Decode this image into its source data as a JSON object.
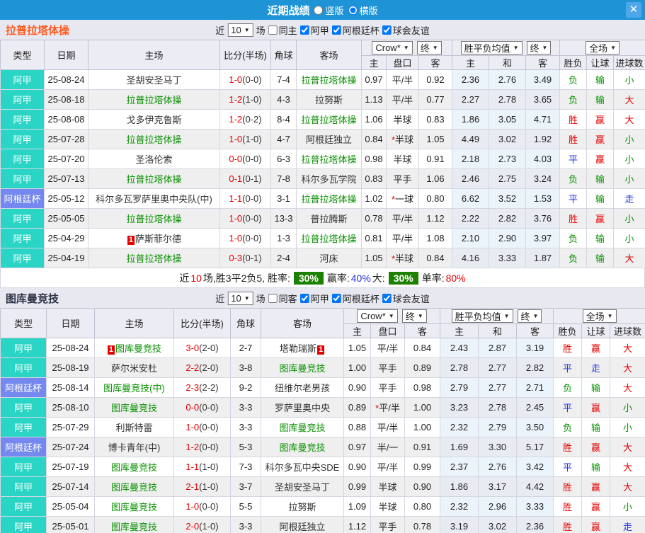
{
  "titlebar": {
    "title": "近期战绩",
    "radio_vertical": {
      "label": "竖版",
      "checked": false
    },
    "radio_horizontal": {
      "label": "横版",
      "checked": true
    },
    "close_glyph": "✕"
  },
  "table_header": {
    "col_type": "类型",
    "col_date": "日期",
    "col_home": "主场",
    "col_score": "比分(半场)",
    "col_corner": "角球",
    "col_away": "客场",
    "sel_crow": "Crow*",
    "sel_end1": "终",
    "sel_mean": "胜平负均值",
    "sel_end2": "终",
    "sel_full": "全场",
    "sub_home": "主",
    "sub_handicap": "盘口",
    "sub_away": "客",
    "sub_mean_home": "主",
    "sub_mean_draw": "和",
    "sub_mean_away": "客",
    "sub_result": "胜负",
    "sub_let": "让球",
    "sub_goals": "进球数"
  },
  "colors": {
    "titlebar_blue": "#1e93d6",
    "league_ajia": "#2bd5c5",
    "league_cup": "#7488ef",
    "focus_green": "#089000",
    "win_red": "#e60000",
    "draw_blue": "#2233dd",
    "chip_green": "#1d8000",
    "section1_title_orange": "#ff5a1e"
  },
  "sections": [
    {
      "title": "拉普拉塔体操",
      "filter": {
        "near": "近",
        "count": "10",
        "games": "场",
        "same": {
          "label": "同主",
          "checked": false
        },
        "leagues": [
          {
            "label": "阿甲",
            "checked": true
          },
          {
            "label": "阿根廷杯",
            "checked": true
          },
          {
            "label": "球会友谊",
            "checked": true
          }
        ]
      },
      "rows": [
        {
          "league": "阿甲",
          "lg": "ajia",
          "date": "25-08-24",
          "home": {
            "name": "圣胡安圣马丁",
            "focus": false
          },
          "score": "1-0",
          "half": "(0-0)",
          "corner": "7-4",
          "away": {
            "name": "拉普拉塔体操",
            "focus": true
          },
          "crow_home": "0.97",
          "handicap": "平/半",
          "star": false,
          "crow_away": "0.92",
          "mean": [
            "2.36",
            "2.76",
            "3.49"
          ],
          "res": [
            "负",
            "g"
          ],
          "let": [
            "输",
            "g"
          ],
          "big": [
            "小",
            "g"
          ]
        },
        {
          "league": "阿甲",
          "lg": "ajia",
          "date": "25-08-18",
          "home": {
            "name": "拉普拉塔体操",
            "focus": true
          },
          "score": "1-2",
          "half": "(1-0)",
          "corner": "4-3",
          "away": {
            "name": "拉努斯",
            "focus": false
          },
          "crow_home": "1.13",
          "handicap": "平/半",
          "star": false,
          "crow_away": "0.77",
          "mean": [
            "2.27",
            "2.78",
            "3.65"
          ],
          "res": [
            "负",
            "g"
          ],
          "let": [
            "输",
            "g"
          ],
          "big": [
            "大",
            "r"
          ]
        },
        {
          "league": "阿甲",
          "lg": "ajia",
          "date": "25-08-08",
          "home": {
            "name": "戈多伊克鲁斯",
            "focus": false
          },
          "score": "1-2",
          "half": "(0-2)",
          "corner": "8-4",
          "away": {
            "name": "拉普拉塔体操",
            "focus": true
          },
          "crow_home": "1.06",
          "handicap": "半球",
          "star": false,
          "crow_away": "0.83",
          "mean": [
            "1.86",
            "3.05",
            "4.71"
          ],
          "res": [
            "胜",
            "r"
          ],
          "let": [
            "赢",
            "r"
          ],
          "big": [
            "大",
            "r"
          ]
        },
        {
          "league": "阿甲",
          "lg": "ajia",
          "date": "25-07-28",
          "home": {
            "name": "拉普拉塔体操",
            "focus": true
          },
          "score": "1-0",
          "half": "(1-0)",
          "corner": "4-7",
          "away": {
            "name": "阿根廷独立",
            "focus": false
          },
          "crow_home": "0.84",
          "handicap": "半球",
          "star": true,
          "crow_away": "1.05",
          "mean": [
            "4.49",
            "3.02",
            "1.92"
          ],
          "res": [
            "胜",
            "r"
          ],
          "let": [
            "赢",
            "r"
          ],
          "big": [
            "小",
            "g"
          ]
        },
        {
          "league": "阿甲",
          "lg": "ajia",
          "date": "25-07-20",
          "home": {
            "name": "圣洛伦索",
            "focus": false
          },
          "score": "0-0",
          "half": "(0-0)",
          "corner": "6-3",
          "away": {
            "name": "拉普拉塔体操",
            "focus": true
          },
          "crow_home": "0.98",
          "handicap": "半球",
          "star": false,
          "crow_away": "0.91",
          "mean": [
            "2.18",
            "2.73",
            "4.03"
          ],
          "res": [
            "平",
            "b"
          ],
          "let": [
            "赢",
            "r"
          ],
          "big": [
            "小",
            "g"
          ]
        },
        {
          "league": "阿甲",
          "lg": "ajia",
          "date": "25-07-13",
          "home": {
            "name": "拉普拉塔体操",
            "focus": true
          },
          "score": "0-1",
          "half": "(0-1)",
          "corner": "7-8",
          "away": {
            "name": "科尔多瓦学院",
            "focus": false
          },
          "crow_home": "0.83",
          "handicap": "平手",
          "star": false,
          "crow_away": "1.06",
          "mean": [
            "2.46",
            "2.75",
            "3.24"
          ],
          "res": [
            "负",
            "g"
          ],
          "let": [
            "输",
            "g"
          ],
          "big": [
            "小",
            "g"
          ]
        },
        {
          "league": "阿根廷杯",
          "lg": "cup",
          "date": "25-05-12",
          "home": {
            "name": "科尔多瓦罗萨里奥中央队(中)",
            "focus": false
          },
          "score": "1-1",
          "half": "(0-0)",
          "corner": "3-1",
          "away": {
            "name": "拉普拉塔体操",
            "focus": true
          },
          "crow_home": "1.02",
          "handicap": "一球",
          "star": true,
          "crow_away": "0.80",
          "mean": [
            "6.62",
            "3.52",
            "1.53"
          ],
          "res": [
            "平",
            "b"
          ],
          "let": [
            "输",
            "g"
          ],
          "big": [
            "走",
            "b"
          ]
        },
        {
          "league": "阿甲",
          "lg": "ajia",
          "date": "25-05-05",
          "home": {
            "name": "拉普拉塔体操",
            "focus": true
          },
          "score": "1-0",
          "half": "(0-0)",
          "corner": "13-3",
          "away": {
            "name": "普拉腾斯",
            "focus": false
          },
          "crow_home": "0.78",
          "handicap": "平/半",
          "star": false,
          "crow_away": "1.12",
          "mean": [
            "2.22",
            "2.82",
            "3.76"
          ],
          "res": [
            "胜",
            "r"
          ],
          "let": [
            "赢",
            "r"
          ],
          "big": [
            "小",
            "g"
          ]
        },
        {
          "league": "阿甲",
          "lg": "ajia",
          "date": "25-04-29",
          "home": {
            "name": "萨斯菲尔德",
            "focus": false,
            "pre": "1"
          },
          "score": "1-0",
          "half": "(0-0)",
          "corner": "1-3",
          "away": {
            "name": "拉普拉塔体操",
            "focus": true
          },
          "crow_home": "0.81",
          "handicap": "平/半",
          "star": false,
          "crow_away": "1.08",
          "mean": [
            "2.10",
            "2.90",
            "3.97"
          ],
          "res": [
            "负",
            "g"
          ],
          "let": [
            "输",
            "g"
          ],
          "big": [
            "小",
            "g"
          ]
        },
        {
          "league": "阿甲",
          "lg": "ajia",
          "date": "25-04-19",
          "home": {
            "name": "拉普拉塔体操",
            "focus": true
          },
          "score": "0-3",
          "half": "(0-1)",
          "corner": "2-4",
          "away": {
            "name": "河床",
            "focus": false
          },
          "crow_home": "1.05",
          "handicap": "半球",
          "star": true,
          "crow_away": "0.84",
          "mean": [
            "4.16",
            "3.33",
            "1.87"
          ],
          "res": [
            "负",
            "g"
          ],
          "let": [
            "输",
            "g"
          ],
          "big": [
            "大",
            "r"
          ]
        }
      ],
      "summary": {
        "seg1": "近",
        "num1": "10",
        "seg2": "场,胜3平2负5, 胜率:",
        "chip1": "30%",
        "seg3": "赢率:",
        "val1": "40%",
        "seg4": "大:",
        "chip2": "30%",
        "seg5": "单率:",
        "val2": "80%"
      }
    },
    {
      "title": "图库曼竞技",
      "filter": {
        "near": "近",
        "count": "10",
        "games": "场",
        "same": {
          "label": "同客",
          "checked": false
        },
        "leagues": [
          {
            "label": "阿甲",
            "checked": true
          },
          {
            "label": "阿根廷杯",
            "checked": true
          },
          {
            "label": "球会友谊",
            "checked": true
          }
        ]
      },
      "rows": [
        {
          "league": "阿甲",
          "lg": "ajia",
          "date": "25-08-24",
          "home": {
            "name": "图库曼竞技",
            "focus": true,
            "pre": "1"
          },
          "score": "3-0",
          "half": "(2-0)",
          "corner": "2-7",
          "away": {
            "name": "塔勒瑞斯",
            "focus": false,
            "post": "1"
          },
          "crow_home": "1.05",
          "handicap": "平/半",
          "star": false,
          "crow_away": "0.84",
          "mean": [
            "2.43",
            "2.87",
            "3.19"
          ],
          "res": [
            "胜",
            "r"
          ],
          "let": [
            "赢",
            "r"
          ],
          "big": [
            "大",
            "r"
          ]
        },
        {
          "league": "阿甲",
          "lg": "ajia",
          "date": "25-08-19",
          "home": {
            "name": "萨尔米安杜",
            "focus": false
          },
          "score": "2-2",
          "half": "(2-0)",
          "corner": "3-8",
          "away": {
            "name": "图库曼竞技",
            "focus": true
          },
          "crow_home": "1.00",
          "handicap": "平手",
          "star": false,
          "crow_away": "0.89",
          "mean": [
            "2.78",
            "2.77",
            "2.82"
          ],
          "res": [
            "平",
            "b"
          ],
          "let": [
            "走",
            "b"
          ],
          "big": [
            "大",
            "r"
          ]
        },
        {
          "league": "阿根廷杯",
          "lg": "cup",
          "date": "25-08-14",
          "home": {
            "name": "图库曼竞技(中)",
            "focus": true
          },
          "score": "2-3",
          "half": "(2-2)",
          "corner": "9-2",
          "away": {
            "name": "纽维尔老男孩",
            "focus": false
          },
          "crow_home": "0.90",
          "handicap": "平手",
          "star": false,
          "crow_away": "0.98",
          "mean": [
            "2.79",
            "2.77",
            "2.71"
          ],
          "res": [
            "负",
            "g"
          ],
          "let": [
            "输",
            "g"
          ],
          "big": [
            "大",
            "r"
          ]
        },
        {
          "league": "阿甲",
          "lg": "ajia",
          "date": "25-08-10",
          "home": {
            "name": "图库曼竞技",
            "focus": true
          },
          "score": "0-0",
          "half": "(0-0)",
          "corner": "3-3",
          "away": {
            "name": "罗萨里奥中央",
            "focus": false
          },
          "crow_home": "0.89",
          "handicap": "平/半",
          "star": true,
          "crow_away": "1.00",
          "mean": [
            "3.23",
            "2.78",
            "2.45"
          ],
          "res": [
            "平",
            "b"
          ],
          "let": [
            "赢",
            "r"
          ],
          "big": [
            "小",
            "g"
          ]
        },
        {
          "league": "阿甲",
          "lg": "ajia",
          "date": "25-07-29",
          "home": {
            "name": "利斯特雷",
            "focus": false
          },
          "score": "1-0",
          "half": "(0-0)",
          "corner": "3-3",
          "away": {
            "name": "图库曼竞技",
            "focus": true
          },
          "crow_home": "0.88",
          "handicap": "平/半",
          "star": false,
          "crow_away": "1.00",
          "mean": [
            "2.32",
            "2.79",
            "3.50"
          ],
          "res": [
            "负",
            "g"
          ],
          "let": [
            "输",
            "g"
          ],
          "big": [
            "小",
            "g"
          ]
        },
        {
          "league": "阿根廷杯",
          "lg": "cup",
          "date": "25-07-24",
          "home": {
            "name": "博卡青年(中)",
            "focus": false
          },
          "score": "1-2",
          "half": "(0-0)",
          "corner": "5-3",
          "away": {
            "name": "图库曼竞技",
            "focus": true
          },
          "crow_home": "0.97",
          "handicap": "半/一",
          "star": false,
          "crow_away": "0.91",
          "mean": [
            "1.69",
            "3.30",
            "5.17"
          ],
          "res": [
            "胜",
            "r"
          ],
          "let": [
            "赢",
            "r"
          ],
          "big": [
            "大",
            "r"
          ]
        },
        {
          "league": "阿甲",
          "lg": "ajia",
          "date": "25-07-19",
          "home": {
            "name": "图库曼竞技",
            "focus": true
          },
          "score": "1-1",
          "half": "(1-0)",
          "corner": "7-3",
          "away": {
            "name": "科尔多瓦中央SDE",
            "focus": false
          },
          "crow_home": "0.90",
          "handicap": "平/半",
          "star": false,
          "crow_away": "0.99",
          "mean": [
            "2.37",
            "2.76",
            "3.42"
          ],
          "res": [
            "平",
            "b"
          ],
          "let": [
            "输",
            "g"
          ],
          "big": [
            "大",
            "r"
          ]
        },
        {
          "league": "阿甲",
          "lg": "ajia",
          "date": "25-07-14",
          "home": {
            "name": "图库曼竞技",
            "focus": true
          },
          "score": "2-1",
          "half": "(1-0)",
          "corner": "3-7",
          "away": {
            "name": "圣胡安圣马丁",
            "focus": false
          },
          "crow_home": "0.99",
          "handicap": "半球",
          "star": false,
          "crow_away": "0.90",
          "mean": [
            "1.86",
            "3.17",
            "4.42"
          ],
          "res": [
            "胜",
            "r"
          ],
          "let": [
            "赢",
            "r"
          ],
          "big": [
            "大",
            "r"
          ]
        },
        {
          "league": "阿甲",
          "lg": "ajia",
          "date": "25-05-04",
          "home": {
            "name": "图库曼竞技",
            "focus": true
          },
          "score": "1-0",
          "half": "(0-0)",
          "corner": "5-5",
          "away": {
            "name": "拉努斯",
            "focus": false
          },
          "crow_home": "1.09",
          "handicap": "半球",
          "star": false,
          "crow_away": "0.80",
          "mean": [
            "2.32",
            "2.96",
            "3.33"
          ],
          "res": [
            "胜",
            "r"
          ],
          "let": [
            "赢",
            "r"
          ],
          "big": [
            "小",
            "g"
          ]
        },
        {
          "league": "阿甲",
          "lg": "ajia",
          "date": "25-05-01",
          "home": {
            "name": "图库曼竞技",
            "focus": true
          },
          "score": "2-0",
          "half": "(1-0)",
          "corner": "3-3",
          "away": {
            "name": "阿根廷独立",
            "focus": false
          },
          "crow_home": "1.12",
          "handicap": "平手",
          "star": false,
          "crow_away": "0.78",
          "mean": [
            "3.19",
            "3.02",
            "2.36"
          ],
          "res": [
            "胜",
            "r"
          ],
          "let": [
            "赢",
            "r"
          ],
          "big": [
            "走",
            "b"
          ]
        }
      ],
      "summary": null
    }
  ]
}
